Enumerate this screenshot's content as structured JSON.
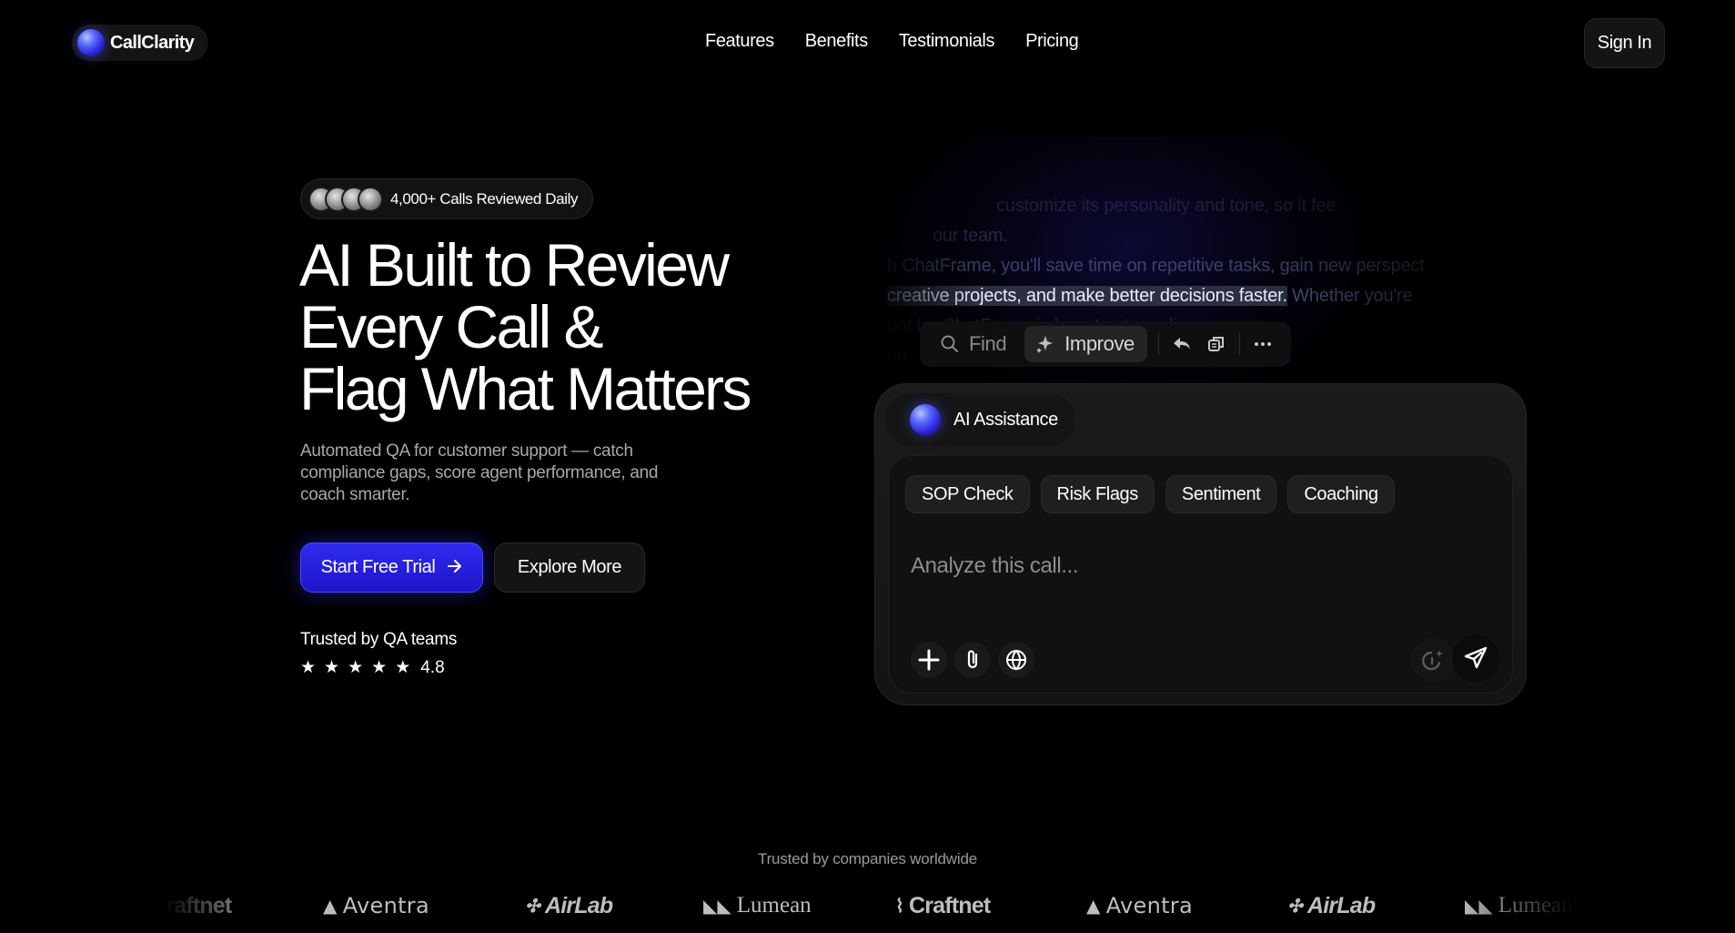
{
  "brand": {
    "name": "CallClarity",
    "icon": "gradient-orb-logo",
    "accent": "#2a23d8"
  },
  "nav": {
    "items": [
      "Features",
      "Benefits",
      "Testimonials",
      "Pricing"
    ],
    "signin": "Sign In"
  },
  "hero": {
    "badge": {
      "text": "4,000+ Calls Reviewed Daily",
      "avatar_count": 4
    },
    "title_lines": [
      "AI Built to Review",
      "Every Call &",
      "Flag What Matters"
    ],
    "subtitle": "Automated QA for customer support — catch compliance gaps, score agent performance, and coach smarter.",
    "cta_primary": "Start Free Trial",
    "cta_primary_icon": "arrow-right-icon",
    "cta_secondary": "Explore More",
    "trusted": "Trusted by QA teams",
    "rating": {
      "stars": 5,
      "value": "4.8"
    }
  },
  "editor": {
    "lines": [
      "customize its personality and tone, so it fee",
      "our team.",
      "h ChatFrame, you'll save time on repetitive tasks, gain new perspect",
      {
        "highlight": "creative projects, and make better decisions faster.",
        "rest": " Whether you're "
      },
      "ent                 for               ChatFrame is here to streamline yo",
      "an"
    ],
    "toolbar": {
      "find": "Find",
      "improve": "Improve",
      "icons": [
        "search-icon",
        "sparkle-icon",
        "reply-icon",
        "copy-icon",
        "more-icon"
      ]
    }
  },
  "assistant": {
    "title": "AI Assistance",
    "chips": [
      "SOP Check",
      "Risk Flags",
      "Sentiment",
      "Coaching"
    ],
    "placeholder": "Analyze this call...",
    "controls": [
      "plus-icon",
      "attach-icon",
      "globe-icon",
      "mic-sparkle-icon",
      "send-icon"
    ]
  },
  "trusted_companies": {
    "label": "Trusted by companies worldwide",
    "logos": [
      "Craftnet",
      "Aventra",
      "AirLab",
      "Lumean",
      "Craftnet",
      "Aventra",
      "AirLab",
      "Lumean"
    ]
  }
}
